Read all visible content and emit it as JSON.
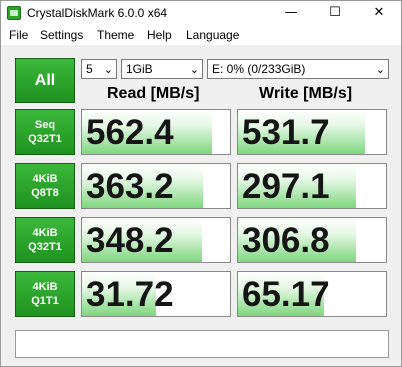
{
  "window": {
    "title": "CrystalDiskMark 6.0.0 x64"
  },
  "window_controls": {
    "minimize": "—",
    "maximize": "☐",
    "close": "✕"
  },
  "menu": [
    "File",
    "Settings",
    "Theme",
    "Help",
    "Language"
  ],
  "controls": {
    "all_label": "All",
    "count": "5",
    "size": "1GiB",
    "drive": "E: 0% (0/233GiB)",
    "dropdown_glyph": "⌄"
  },
  "headers": {
    "read": "Read [MB/s]",
    "write": "Write [MB/s]"
  },
  "tests": [
    {
      "line1": "Seq",
      "line2": "Q32T1",
      "read": "562.4",
      "write": "531.7",
      "read_fill_pct": 88,
      "write_fill_pct": 86
    },
    {
      "line1": "4KiB",
      "line2": "Q8T8",
      "read": "363.2",
      "write": "297.1",
      "read_fill_pct": 82,
      "write_fill_pct": 80
    },
    {
      "line1": "4KiB",
      "line2": "Q32T1",
      "read": "348.2",
      "write": "306.8",
      "read_fill_pct": 81,
      "write_fill_pct": 80
    },
    {
      "line1": "4KiB",
      "line2": "Q1T1",
      "read": "31.72",
      "write": "65.17",
      "read_fill_pct": 50,
      "write_fill_pct": 58
    }
  ],
  "comment": ""
}
